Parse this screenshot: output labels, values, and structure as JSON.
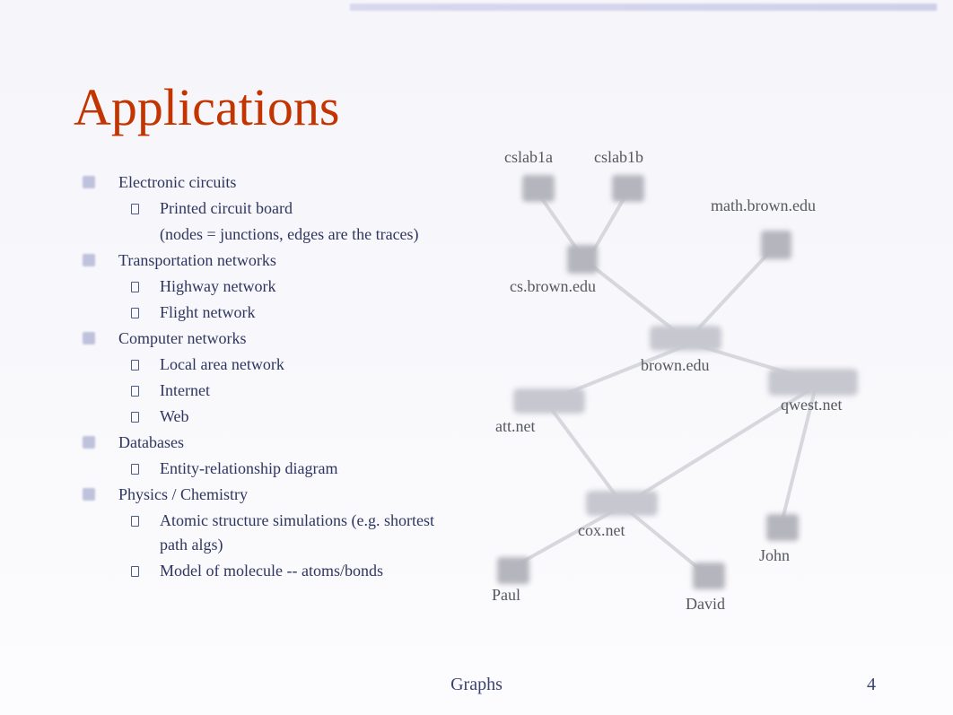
{
  "title": "Applications",
  "bullets": [
    {
      "label": "Electronic circuits",
      "children": [
        {
          "label": "Printed circuit board",
          "sub": "(nodes = junctions, edges are the traces)"
        }
      ]
    },
    {
      "label": "Transportation networks",
      "children": [
        {
          "label": "Highway network"
        },
        {
          "label": "Flight network"
        }
      ]
    },
    {
      "label": "Computer networks",
      "children": [
        {
          "label": "Local area network"
        },
        {
          "label": "Internet"
        },
        {
          "label": "Web"
        }
      ]
    },
    {
      "label": "Databases",
      "children": [
        {
          "label": "Entity-relationship diagram"
        }
      ]
    },
    {
      "label": "Physics / Chemistry",
      "children": [
        {
          "label": "Atomic structure simulations (e.g. shortest path algs)"
        },
        {
          "label": "Model of molecule -- atoms/bonds"
        }
      ]
    }
  ],
  "diagram": {
    "nodes": {
      "cslab1a": "cslab1a",
      "cslab1b": "cslab1b",
      "mathbrown": "math.brown.edu",
      "csbrown": "cs.brown.edu",
      "brown": "brown.edu",
      "att": "att.net",
      "qwest": "qwest.net",
      "cox": "cox.net",
      "john": "John",
      "paul": "Paul",
      "david": "David"
    }
  },
  "footer": {
    "label": "Graphs",
    "page": "4"
  }
}
